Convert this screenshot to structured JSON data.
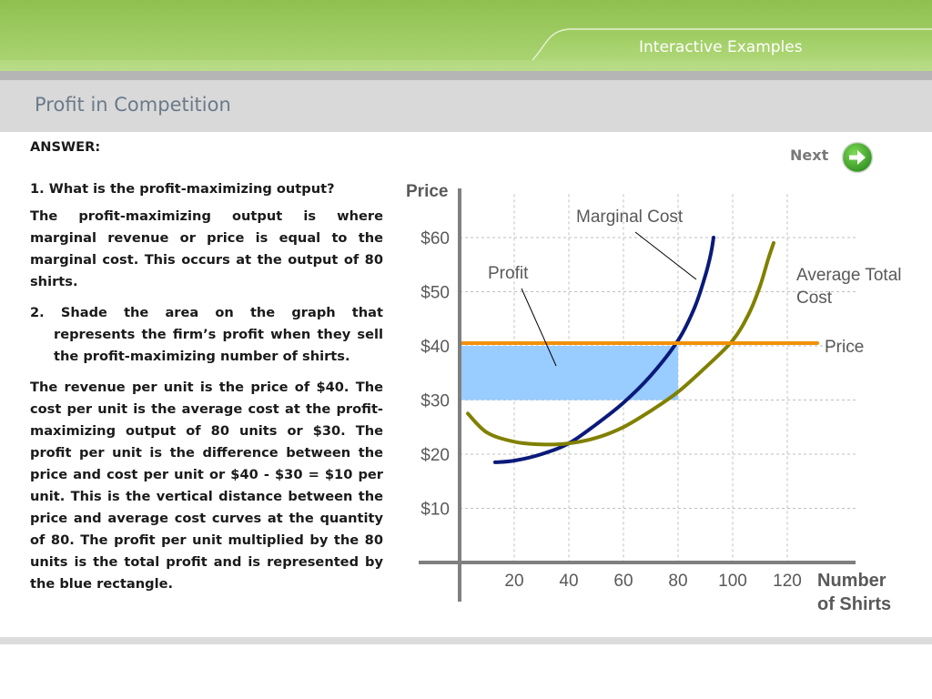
{
  "header": {
    "banner_title": "Interactive Examples",
    "page_title": "Profit in Competition"
  },
  "nav": {
    "next_label": "Next"
  },
  "content": {
    "answer_label": "ANSWER:",
    "q1": "1.   What is the profit-maximizing output?",
    "a1": "The profit-maximizing output is where marginal revenue or price is equal to the marginal cost.  This occurs at the output of 80 shirts.",
    "q2": "2.  Shade the area on the graph that represents the firm’s profit when they sell the profit-maximizing number of shirts.",
    "a2": "The revenue per unit is the price of $40.  The cost per unit is the average cost at the profit-maximizing output of 80 units or $30.  The profit per unit is the difference between the price and cost per unit or $40 - $30 = $10 per unit.  This is the vertical distance between the price and average cost curves at the quantity of 80.  The profit per unit multiplied by the 80 units is the total profit and is represented by the blue rectangle."
  },
  "chart_data": {
    "type": "line",
    "ylabel": "Price",
    "xlabel": "Number of Shirts",
    "x_ticks": [
      20,
      40,
      60,
      80,
      100,
      120
    ],
    "y_ticks": [
      10,
      20,
      30,
      40,
      50,
      60
    ],
    "x_tick_labels": [
      "20",
      "40",
      "60",
      "80",
      "100",
      "120"
    ],
    "y_tick_labels": [
      "$10",
      "$20",
      "$30",
      "$40",
      "$50",
      "$60"
    ],
    "xlim": [
      0,
      145
    ],
    "ylim": [
      0,
      68
    ],
    "grid": true,
    "series": [
      {
        "name": "Marginal Cost",
        "color": "#0a1a7a",
        "points": [
          [
            13,
            18.5
          ],
          [
            20,
            18.8
          ],
          [
            30,
            20
          ],
          [
            40,
            22
          ],
          [
            50,
            25.5
          ],
          [
            60,
            29.5
          ],
          [
            70,
            34.5
          ],
          [
            80,
            41
          ],
          [
            86,
            47
          ],
          [
            90,
            53
          ],
          [
            92,
            57
          ],
          [
            93,
            60
          ]
        ]
      },
      {
        "name": "Average Total Cost",
        "color": "#808000",
        "points": [
          [
            3,
            27.5
          ],
          [
            10,
            24
          ],
          [
            20,
            22.3
          ],
          [
            30,
            21.8
          ],
          [
            40,
            22
          ],
          [
            50,
            23
          ],
          [
            60,
            25
          ],
          [
            70,
            28
          ],
          [
            80,
            31.5
          ],
          [
            90,
            36
          ],
          [
            100,
            41
          ],
          [
            106,
            46
          ],
          [
            110,
            51
          ],
          [
            113,
            56
          ],
          [
            115,
            59
          ]
        ]
      },
      {
        "name": "Price",
        "color": "#f0900a",
        "points": [
          [
            0,
            40.5
          ],
          [
            131,
            40.5
          ]
        ]
      }
    ],
    "profit_area": {
      "name": "Profit",
      "x0": 0,
      "x1": 80,
      "y0": 30,
      "y1": 40,
      "color": "#99ccff"
    },
    "annotations": [
      {
        "text": "Marginal Cost",
        "target_series": "Marginal Cost"
      },
      {
        "text": "Profit",
        "target": "profit_area"
      },
      {
        "text": "Average Total Cost",
        "target_series": "Average Total Cost"
      },
      {
        "text": "Price",
        "target_series": "Price"
      }
    ],
    "colors": {
      "axis": "#7f7f7f",
      "grid": "#bfbfbf",
      "text": "#595959"
    }
  }
}
